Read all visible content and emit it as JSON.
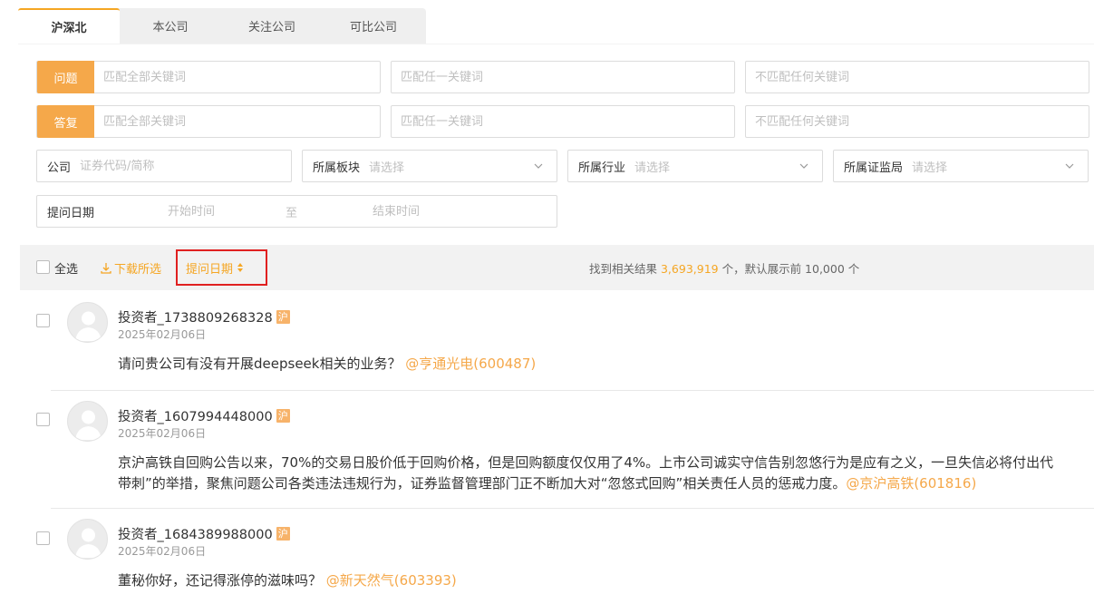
{
  "tabs": [
    {
      "label": "沪深北",
      "active": true
    },
    {
      "label": "本公司",
      "active": false
    },
    {
      "label": "关注公司",
      "active": false
    },
    {
      "label": "可比公司",
      "active": false
    }
  ],
  "search": {
    "question_label": "问题",
    "answer_label": "答复",
    "placeholder_all": "匹配全部关键词",
    "placeholder_any": "匹配任一关键词",
    "placeholder_none": "不匹配任何关键词",
    "company_label": "公司",
    "company_placeholder": "证券代码/简称",
    "sector_label": "所属板块",
    "industry_label": "所属行业",
    "regulator_label": "所属证监局",
    "select_placeholder": "请选择",
    "date_label": "提问日期",
    "start_placeholder": "开始时间",
    "to": "至",
    "end_placeholder": "结束时间"
  },
  "toolbar": {
    "select_all": "全选",
    "download": "下载所选",
    "sort_label": "提问日期",
    "result_prefix": "找到相关结果 ",
    "result_count": "3,693,919",
    "result_suffix": " 个，默认展示前 10,000 个"
  },
  "items": [
    {
      "user": "投资者_1738809268328",
      "market": "沪",
      "date": "2025年02月06日",
      "lines": [
        "请问贵公司有没有开展deepseek相关的业务？"
      ],
      "company_tag": "@亨通光电(600487)"
    },
    {
      "user": "投资者_1607994448000",
      "market": "沪",
      "date": "2025年02月06日",
      "lines": [
        "京沪高铁自回购公告以来，70%的交易日股价低于回购价格，但是回购额度仅仅用了4%。上市公司诚实守信告别忽悠行为是应有之义，一旦失信必将付出代",
        "带刺”的举措，聚焦问题公司各类违法违规行为，证券监督管理部门正不断加大对“忽悠式回购”相关责任人员的惩戒力度。"
      ],
      "company_tag": "@京沪高铁(601816)"
    },
    {
      "user": "投资者_1684389988000",
      "market": "沪",
      "date": "2025年02月06日",
      "lines": [
        "董秘你好，还记得涨停的滋味吗？"
      ],
      "company_tag": "@新天然气(603393)"
    }
  ],
  "colors": {
    "accent": "#f5a623",
    "tag_bg": "#f5a84a",
    "highlight_box": "#e02020"
  },
  "icons": [
    "chevron-down-icon",
    "download-icon",
    "sort-icon",
    "avatar-placeholder-icon"
  ]
}
